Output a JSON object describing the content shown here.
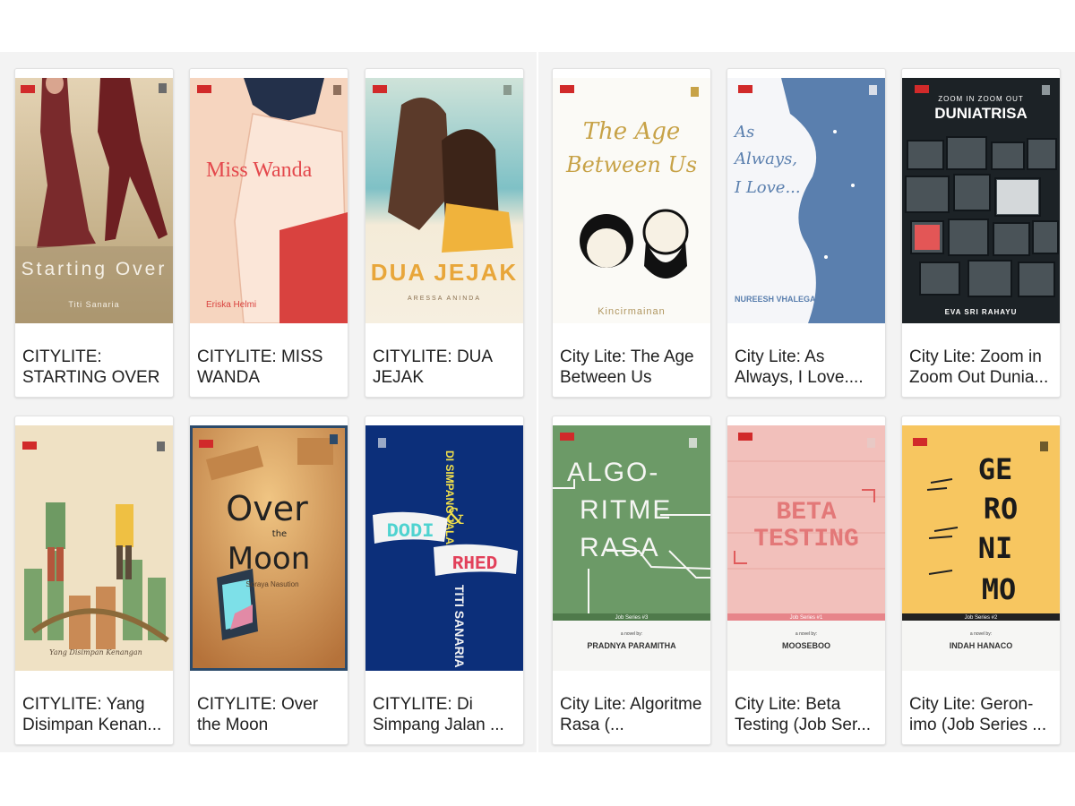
{
  "books": [
    {
      "title": "CITYLITE: STARTING OVER",
      "cover_title": "Starting Over",
      "author": "Titi Sanaria",
      "accent": "#b8a27a"
    },
    {
      "title": "CITYLITE: MISS WANDA",
      "cover_title": "Miss Wanda",
      "author": "Eriska Helmi",
      "accent": "#e4494d"
    },
    {
      "title": "CITYLITE: DUA JEJAK",
      "cover_title": "DUA JEJAK",
      "author": "ARESSA ANINDA",
      "accent": "#e8a63a"
    },
    {
      "title": "City Lite: The Age Between Us",
      "cover_title": "The Age Between Us",
      "author": "Kincirmainan",
      "accent": "#c7a247"
    },
    {
      "title": "City Lite: As Always, I Love....",
      "cover_title": "As Always, I Love...",
      "author": "NUREESH VHALEGA",
      "accent": "#5a7fae"
    },
    {
      "title": "City Lite: Zoom in Zoom Out Dunia...",
      "cover_title": "DUNIATRISA",
      "cover_subtitle": "ZOOM IN ZOOM OUT",
      "author": "EVA SRI RAHAYU",
      "accent": "#2a3035"
    },
    {
      "title": "CITYLITE: Yang Disimpan Kenan...",
      "cover_title": "Yang Disimpan Kenangan",
      "author": "",
      "accent": "#7aa36b"
    },
    {
      "title": "CITYLITE: Over the Moon",
      "cover_title": "Over the Moon",
      "author": "Soraya Nasution",
      "accent": "#d69a55"
    },
    {
      "title": "CITYLITE: Di Simpang Jalan ...",
      "cover_title": "DI SIMPANG JALAN",
      "cover_names": [
        "DODI",
        "RHED"
      ],
      "author": "TITI SANARIA",
      "accent": "#0c2f7a"
    },
    {
      "title": "City Lite: Algoritme Rasa (...",
      "cover_lines": [
        "ALGO-",
        "RITME",
        "RASA"
      ],
      "series": "Job Series #3",
      "byline": "a novel by:",
      "author": "PRADNYA PARAMITHA",
      "accent": "#6c9a67"
    },
    {
      "title": "City Lite: Beta Testing (Job Ser...",
      "cover_lines": [
        "BETA",
        "TESTING"
      ],
      "series": "Job Series #1",
      "byline": "a novel by:",
      "author": "MOOSEBOO",
      "accent": "#f2c0bb"
    },
    {
      "title": "City Lite: Geron-imo (Job Series ...",
      "cover_lines": [
        "GE",
        "RO",
        "NI",
        "MO"
      ],
      "series": "Job Series #2",
      "byline": "a novel by:",
      "author": "INDAH HANACO",
      "accent": "#f7c660"
    }
  ]
}
